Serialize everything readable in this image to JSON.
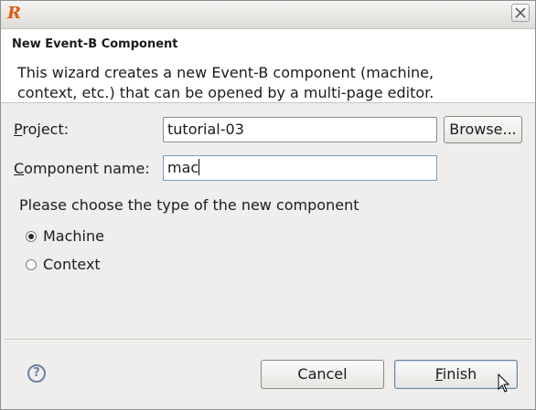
{
  "window": {
    "app_icon": "R",
    "close_icon": "close-icon"
  },
  "header": {
    "title": "New Event-B Component",
    "description": "This wizard creates a new Event-B component (machine, context, etc.) that can be opened by a multi-page editor."
  },
  "form": {
    "project": {
      "label_first": "P",
      "label_rest": "roject:",
      "value": "tutorial-03"
    },
    "browse_button": "Browse...",
    "component_name": {
      "label_first": "C",
      "label_rest": "omponent name:",
      "value": "mac"
    }
  },
  "type_group": {
    "label": "Please choose the type of the new component",
    "options": [
      {
        "label": "Machine",
        "checked": true
      },
      {
        "label": "Context",
        "checked": false
      }
    ]
  },
  "footer": {
    "help_icon": "?",
    "cancel_label": "Cancel",
    "finish_first": "F",
    "finish_rest": "inish"
  },
  "colors": {
    "accent": "#6f86a8",
    "app_icon": "#e05a10",
    "dialog_bg": "#efeeec"
  }
}
